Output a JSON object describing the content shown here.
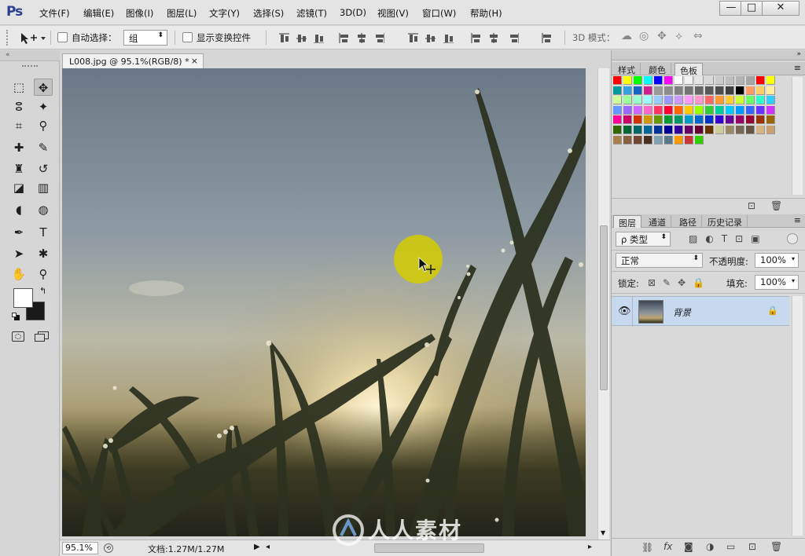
{
  "app": {
    "logo": "Ps"
  },
  "menu": [
    "文件(F)",
    "编辑(E)",
    "图像(I)",
    "图层(L)",
    "文字(Y)",
    "选择(S)",
    "滤镜(T)",
    "3D(D)",
    "视图(V)",
    "窗口(W)",
    "帮助(H)"
  ],
  "window_controls": {
    "minimize": "—",
    "maximize": "□",
    "close": "✕"
  },
  "options": {
    "auto_select_label": "自动选择：",
    "auto_select_value": "组",
    "show_transform_label": "显示变换控件",
    "mode_3d_label": "3D 模式："
  },
  "document": {
    "tab_title": "L008.jpg @ 95.1%(RGB/8) *",
    "tab_close": "×",
    "zoom": "95.1%",
    "info": "文档:1.27M/1.27M"
  },
  "swatch_panel": {
    "tabs": [
      "样式",
      "颜色",
      "色板"
    ],
    "active_tab": "色板",
    "colors": [
      "#ff0000",
      "#ffff00",
      "#00ff00",
      "#00ffff",
      "#0000ff",
      "#ff00ff",
      "#ffffff",
      "#f2f2f2",
      "#e6e6e6",
      "#d9d9d9",
      "#cccccc",
      "#bfbfbf",
      "#b3b3b3",
      "#a6a6a6",
      "#ff0000",
      "#ffff00",
      "#009a9a",
      "#33a0e0",
      "#1565c0",
      "#d02090",
      "#999999",
      "#8c8c8c",
      "#808080",
      "#737373",
      "#666666",
      "#595959",
      "#4d4d4d",
      "#404040",
      "#000000",
      "#ff9966",
      "#ffcc66",
      "#ffee99",
      "#ccff99",
      "#99ff99",
      "#99ffcc",
      "#99ffff",
      "#99ccff",
      "#9999ff",
      "#cc99ff",
      "#ff99ff",
      "#ff99cc",
      "#ff6666",
      "#ff9933",
      "#ffcc33",
      "#ccff33",
      "#66ff66",
      "#33ffcc",
      "#33ccff",
      "#6699ff",
      "#9966ff",
      "#cc66ff",
      "#ff66cc",
      "#ff3366",
      "#ff0033",
      "#ff6600",
      "#ffcc00",
      "#99ff00",
      "#33cc33",
      "#00cc99",
      "#00ccff",
      "#0099ff",
      "#3366ff",
      "#6633ff",
      "#cc33ff",
      "#ff0099",
      "#cc0066",
      "#cc3300",
      "#cc9900",
      "#669900",
      "#009933",
      "#009966",
      "#0099cc",
      "#0066cc",
      "#0033cc",
      "#3300cc",
      "#660099",
      "#990066",
      "#990033",
      "#993300",
      "#996600",
      "#336600",
      "#006633",
      "#006666",
      "#006699",
      "#003399",
      "#000099",
      "#330099",
      "#660066",
      "#660033",
      "#663300",
      "#cccc99",
      "#998866",
      "#776655",
      "#665544",
      "#d4b483",
      "#c8a070",
      "#a88050",
      "#886040",
      "#704830",
      "#4a3020",
      "#80a0b0",
      "#5a7a8a",
      "#ff9900",
      "#cc3333",
      "#33cc00"
    ],
    "footer_icons": [
      "new-swatch-icon",
      "trash-icon"
    ]
  },
  "layers_panel": {
    "tabs": [
      "图层",
      "通道",
      "路径",
      "历史记录"
    ],
    "active_tab": "图层",
    "filter_label": "ρ 类型",
    "blend_mode": "正常",
    "opacity_label": "不透明度:",
    "opacity_value": "100%",
    "lock_label": "锁定:",
    "fill_label": "填充:",
    "fill_value": "100%",
    "layers": [
      {
        "name": "背景",
        "visible": true,
        "locked": true
      }
    ],
    "footer_icons": [
      "link-icon",
      "fx-icon",
      "mask-icon",
      "adjustment-icon",
      "group-icon",
      "new-layer-icon",
      "trash-icon"
    ],
    "footer_fx": "fx"
  },
  "watermark": {
    "text": "人人素材"
  },
  "colors": {
    "selected_layer": "#c6d9ef",
    "cursor_highlight": "#d4cc00"
  }
}
